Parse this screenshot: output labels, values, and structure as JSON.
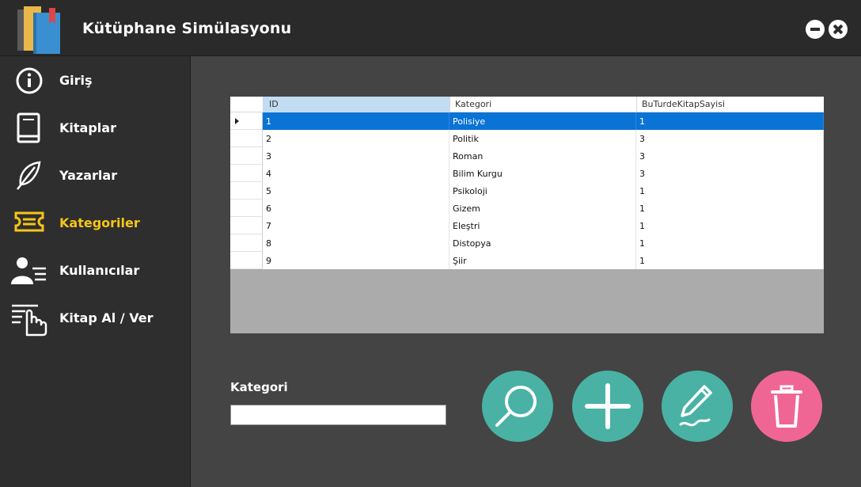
{
  "window": {
    "title": "Kütüphane Simülasyonu",
    "minimize_icon": "minimize-circle-icon",
    "close_icon": "close-circle-icon"
  },
  "sidebar": {
    "items": [
      {
        "label": "Giriş",
        "icon": "info-icon",
        "active": false
      },
      {
        "label": "Kitaplar",
        "icon": "book-icon",
        "active": false
      },
      {
        "label": "Yazarlar",
        "icon": "feather-icon",
        "active": false
      },
      {
        "label": "Kategoriler",
        "icon": "tag-icon",
        "active": true
      },
      {
        "label": "Kullanıcılar",
        "icon": "users-list-icon",
        "active": false
      },
      {
        "label": "Kitap Al / Ver",
        "icon": "hand-pointer-icon",
        "active": false
      }
    ],
    "active_color": "#f5c518"
  },
  "table": {
    "columns": [
      "ID",
      "Kategori",
      "BuTurdeKitapSayisi"
    ],
    "rows": [
      [
        "1",
        "Polisiye",
        "1"
      ],
      [
        "2",
        "Politik",
        "3"
      ],
      [
        "3",
        "Roman",
        "3"
      ],
      [
        "4",
        "Bilim Kurgu",
        "3"
      ],
      [
        "5",
        "Psikoloji",
        "1"
      ],
      [
        "6",
        "Gizem",
        "1"
      ],
      [
        "7",
        "Eleştri",
        "1"
      ],
      [
        "8",
        "Distopya",
        "1"
      ],
      [
        "9",
        "Şiir",
        "1"
      ]
    ],
    "selected_row": 0,
    "selection_color": "#0a73d6"
  },
  "form": {
    "kategori_label": "Kategori",
    "kategori_value": ""
  },
  "actions": {
    "search": {
      "icon": "search-icon",
      "color": "#49b2a4"
    },
    "add": {
      "icon": "plus-icon",
      "color": "#49b2a4"
    },
    "edit": {
      "icon": "pencil-icon",
      "color": "#49b2a4"
    },
    "delete": {
      "icon": "trash-icon",
      "color": "#ef6694"
    }
  }
}
